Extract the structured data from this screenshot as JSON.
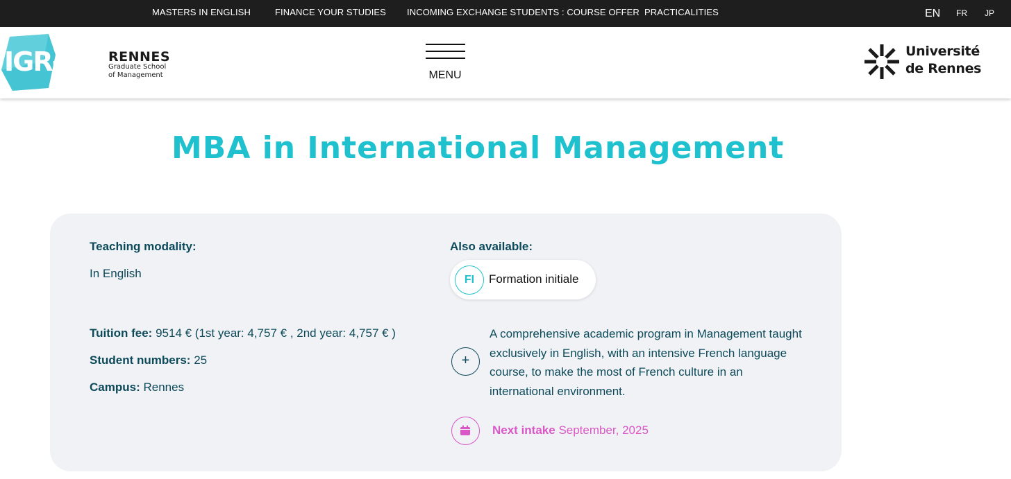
{
  "topbar": {
    "nav": [
      "MASTERS IN ENGLISH",
      "FINANCE YOUR STUDIES",
      "INCOMING EXCHANGE STUDENTS : COURSE OFFER",
      "PRACTICALITIES"
    ],
    "languages": [
      "EN",
      "FR",
      "JP"
    ],
    "active_language": "EN"
  },
  "header": {
    "logo": {
      "brand": "IGR-IAE",
      "city": "RENNES",
      "line1": "Graduate School",
      "line2": "of Management"
    },
    "menu_label": "MENU",
    "university": {
      "line1": "Université",
      "line2": "de Rennes"
    }
  },
  "page": {
    "title": "MBA in International Management"
  },
  "card": {
    "teaching_modality_label": "Teaching modality:",
    "teaching_modality_value": "In English",
    "also_available_label": "Also available:",
    "formation": {
      "badge": "FI",
      "label": "Formation initiale"
    },
    "tuition_label": "Tuition fee:",
    "tuition_value": "9514 € (1st year: 4,757 € , 2nd year: 4,757 € )",
    "students_label": "Student numbers:",
    "students_value": "25",
    "campus_label": "Campus:",
    "campus_value": "Rennes",
    "description": "A comprehensive academic program in Management taught exclusively in English, with an intensive French language course, to make the most of French culture in an international environment.",
    "expand_symbol": "+",
    "next_intake_label": "Next intake",
    "next_intake_value": "September, 2025"
  },
  "colors": {
    "accent_teal": "#1fc1cf",
    "text_dark_teal": "#0c4a5a",
    "accent_pink": "#d957c6",
    "topbar_bg": "#1e1e1e",
    "card_bg": "#f1f2f6"
  },
  "icons": [
    "hamburger-icon",
    "plus-icon",
    "calendar-icon",
    "university-star-icon"
  ]
}
